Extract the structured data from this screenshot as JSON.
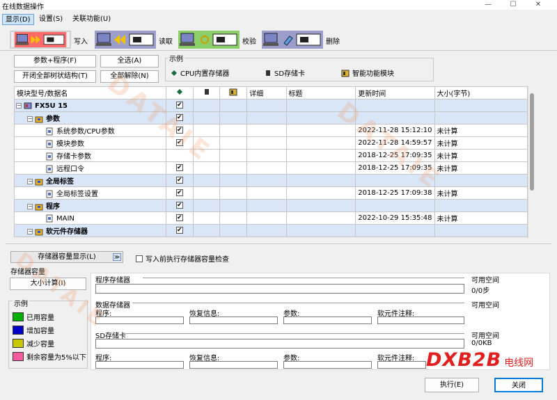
{
  "window": {
    "title": "在线数据操作",
    "min": "—",
    "max": "☐",
    "close": "✕"
  },
  "menu": [
    "显示(D)",
    "设置(S)",
    "关联功能(U)"
  ],
  "tabs": [
    "写入",
    "读取",
    "校验",
    "删除"
  ],
  "buttons": {
    "param_prog": "参数+程序(F)",
    "select_all": "全选(A)",
    "expand_all": "开闭全部树状结构(T)",
    "deselect_all": "全部解除(N)"
  },
  "legend": {
    "title": "示例",
    "items": [
      "CPU内置存储器",
      "SD存储卡",
      "智能功能模块"
    ]
  },
  "table": {
    "headers": [
      "模块型号/数据名",
      "",
      "",
      "",
      "详细",
      "标题",
      "更新时间",
      "大小(字节)"
    ],
    "rows": [
      {
        "name": "FX5U 15",
        "level": 0,
        "toggle": "⊟",
        "bold": true,
        "hl": true,
        "cpu": true,
        "time": "",
        "size": ""
      },
      {
        "name": "参数",
        "level": 1,
        "toggle": "⊟",
        "bold": true,
        "hl": true,
        "cpu": true,
        "time": "",
        "size": ""
      },
      {
        "name": "系统参数/CPU参数",
        "level": 2,
        "toggle": "",
        "bold": false,
        "hl": false,
        "cpu": true,
        "time": "2022-11-28 15:12:10",
        "size": "未计算"
      },
      {
        "name": "模块参数",
        "level": 2,
        "toggle": "",
        "bold": false,
        "hl": false,
        "cpu": true,
        "time": "2022-11-28 14:59:57",
        "size": "未计算"
      },
      {
        "name": "存储卡参数",
        "level": 2,
        "toggle": "",
        "bold": false,
        "hl": false,
        "cpu": false,
        "time": "2018-12-25 17:09:35",
        "size": "未计算"
      },
      {
        "name": "远程口令",
        "level": 2,
        "toggle": "",
        "bold": false,
        "hl": false,
        "cpu": true,
        "time": "2018-12-25 17:09:35",
        "size": "未计算"
      },
      {
        "name": "全局标签",
        "level": 1,
        "toggle": "⊟",
        "bold": true,
        "hl": true,
        "cpu": true,
        "time": "",
        "size": ""
      },
      {
        "name": "全局标签设置",
        "level": 2,
        "toggle": "",
        "bold": false,
        "hl": false,
        "cpu": true,
        "time": "2018-12-25 17:09:38",
        "size": "未计算"
      },
      {
        "name": "程序",
        "level": 1,
        "toggle": "⊟",
        "bold": true,
        "hl": true,
        "cpu": true,
        "time": "",
        "size": ""
      },
      {
        "name": "MAIN",
        "level": 2,
        "toggle": "",
        "bold": false,
        "hl": false,
        "cpu": true,
        "time": "2022-10-29 15:35:48",
        "size": "未计算"
      },
      {
        "name": "软元件存储器",
        "level": 1,
        "toggle": "⊟",
        "bold": true,
        "hl": true,
        "cpu": true,
        "time": "",
        "size": ""
      }
    ]
  },
  "capacity_dropdown": "存储器容量显示(L)",
  "precheck_label": "写入前执行存储器容量检查",
  "capacity": {
    "title": "存储器容量",
    "calc_button": "大小计算(I)",
    "legend_title": "示例",
    "legend_items": [
      {
        "label": "已用容量",
        "color": "#00b000"
      },
      {
        "label": "增加容量",
        "color": "#0000c8"
      },
      {
        "label": "减少容量",
        "color": "#c8c800"
      },
      {
        "label": "剩余容量为5%以下",
        "color": "#ff5aa0"
      }
    ],
    "program_mem": "程序存储器",
    "free_space": "可用空间",
    "program_free": "0/0步",
    "data_mem": "数据存储器",
    "sd_card": "SD存储卡",
    "sd_free": "0/0KB",
    "fields": [
      "程序:",
      "恢复信息:",
      "参数:",
      "软元件注释:"
    ]
  },
  "footer": {
    "execute": "执行(E)",
    "close": "关闭"
  },
  "watermark": {
    "brand": "DXB2B",
    "suffix": "电线网",
    "bg_text": "DATAIE"
  }
}
